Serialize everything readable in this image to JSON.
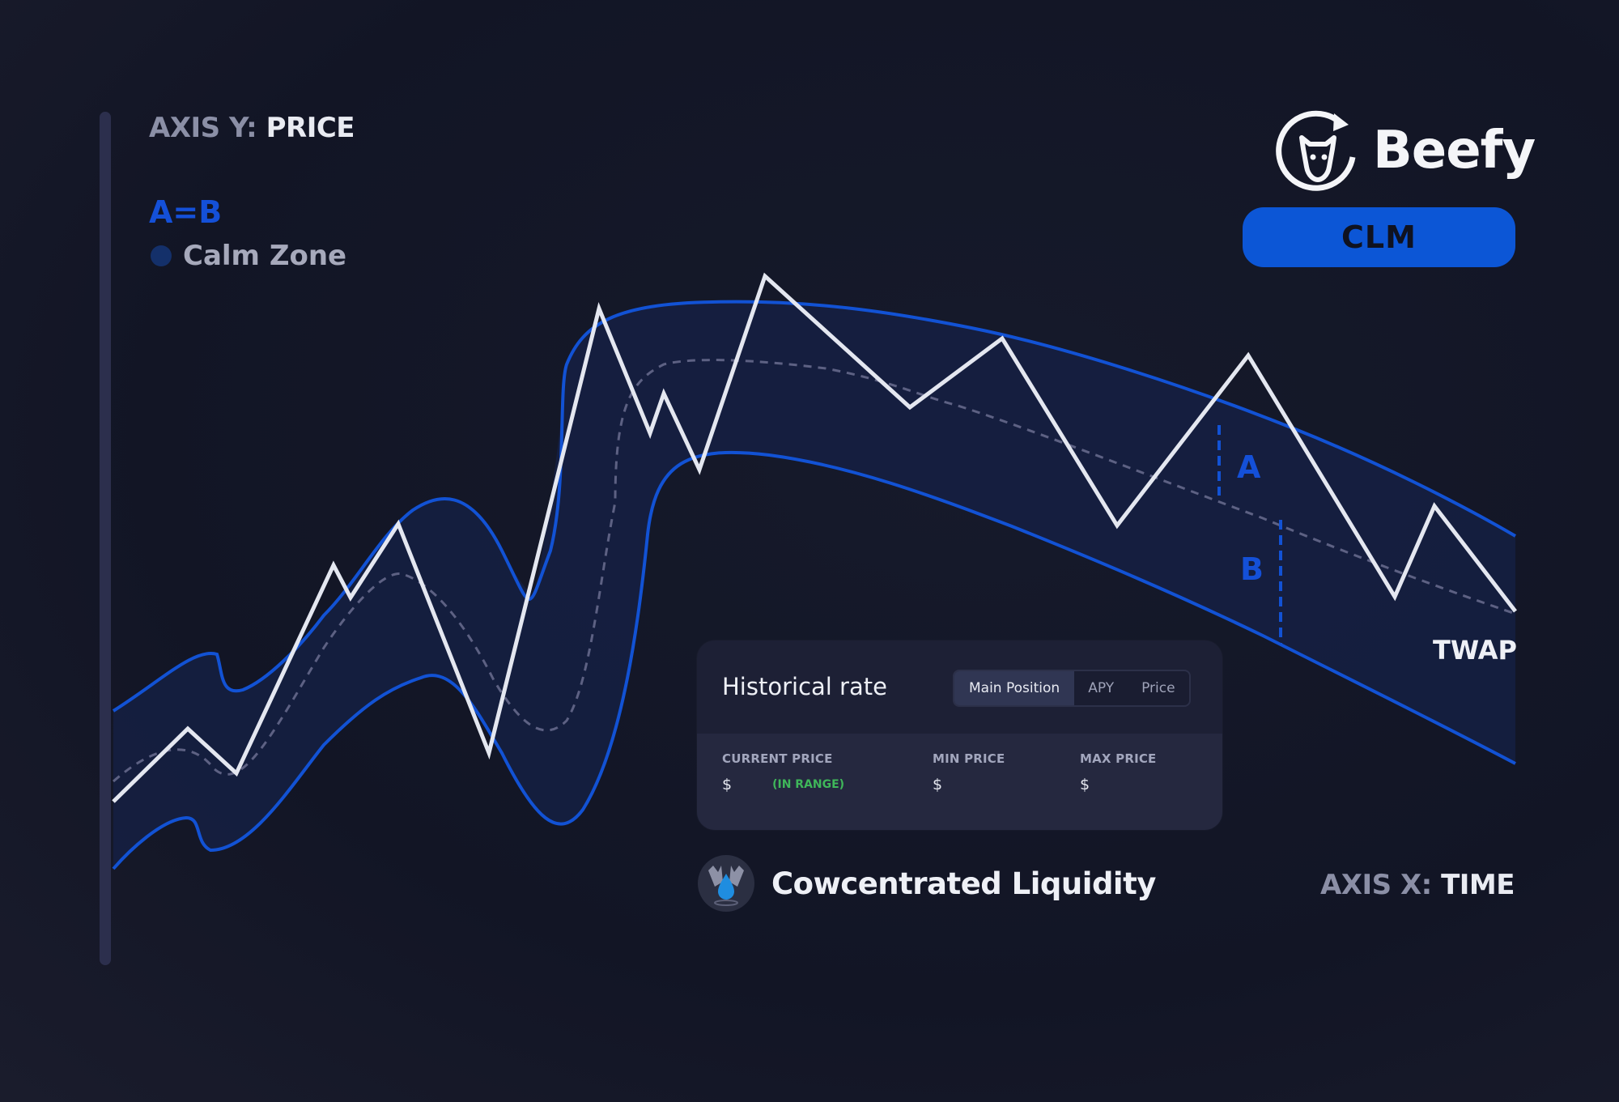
{
  "axis_y": {
    "prefix": "AXIS Y:",
    "name": "PRICE"
  },
  "axis_x": {
    "prefix": "AXIS X:",
    "name": "TIME"
  },
  "legend": {
    "equation": "A=B",
    "zone_label": "Calm Zone"
  },
  "brand": {
    "name": "Beefy",
    "badge": "CLM"
  },
  "annotations": {
    "twap": "TWAP",
    "segment_a": "A",
    "segment_b": "B"
  },
  "colors": {
    "background": "#141729",
    "band_fill": "#152043",
    "band_edge": "#1252d4",
    "price_line": "#e4e7f0",
    "twap_line": "#5d6183",
    "accent": "#0c56d6",
    "in_range": "#3fb75a"
  },
  "card": {
    "title": "Historical rate",
    "tabs": [
      {
        "label": "Main Position",
        "active": true
      },
      {
        "label": "APY",
        "active": false
      },
      {
        "label": "Price",
        "active": false
      }
    ],
    "current_price": {
      "label": "CURRENT PRICE",
      "value": "$",
      "status": "(IN RANGE)"
    },
    "min_price": {
      "label": "MIN PRICE",
      "value": "$"
    },
    "max_price": {
      "label": "MAX PRICE",
      "value": "$"
    }
  },
  "footer": {
    "title": "Cowcentrated Liquidity",
    "logo_icon": "water-drop-cows-icon"
  }
}
